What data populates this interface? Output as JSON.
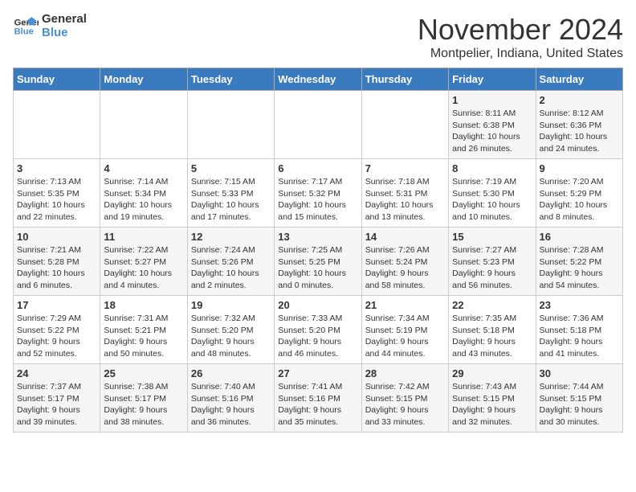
{
  "logo": {
    "line1": "General",
    "line2": "Blue"
  },
  "title": "November 2024",
  "location": "Montpelier, Indiana, United States",
  "weekdays": [
    "Sunday",
    "Monday",
    "Tuesday",
    "Wednesday",
    "Thursday",
    "Friday",
    "Saturday"
  ],
  "weeks": [
    [
      {
        "day": "",
        "info": ""
      },
      {
        "day": "",
        "info": ""
      },
      {
        "day": "",
        "info": ""
      },
      {
        "day": "",
        "info": ""
      },
      {
        "day": "",
        "info": ""
      },
      {
        "day": "1",
        "info": "Sunrise: 8:11 AM\nSunset: 6:38 PM\nDaylight: 10 hours\nand 26 minutes."
      },
      {
        "day": "2",
        "info": "Sunrise: 8:12 AM\nSunset: 6:36 PM\nDaylight: 10 hours\nand 24 minutes."
      }
    ],
    [
      {
        "day": "3",
        "info": "Sunrise: 7:13 AM\nSunset: 5:35 PM\nDaylight: 10 hours\nand 22 minutes."
      },
      {
        "day": "4",
        "info": "Sunrise: 7:14 AM\nSunset: 5:34 PM\nDaylight: 10 hours\nand 19 minutes."
      },
      {
        "day": "5",
        "info": "Sunrise: 7:15 AM\nSunset: 5:33 PM\nDaylight: 10 hours\nand 17 minutes."
      },
      {
        "day": "6",
        "info": "Sunrise: 7:17 AM\nSunset: 5:32 PM\nDaylight: 10 hours\nand 15 minutes."
      },
      {
        "day": "7",
        "info": "Sunrise: 7:18 AM\nSunset: 5:31 PM\nDaylight: 10 hours\nand 13 minutes."
      },
      {
        "day": "8",
        "info": "Sunrise: 7:19 AM\nSunset: 5:30 PM\nDaylight: 10 hours\nand 10 minutes."
      },
      {
        "day": "9",
        "info": "Sunrise: 7:20 AM\nSunset: 5:29 PM\nDaylight: 10 hours\nand 8 minutes."
      }
    ],
    [
      {
        "day": "10",
        "info": "Sunrise: 7:21 AM\nSunset: 5:28 PM\nDaylight: 10 hours\nand 6 minutes."
      },
      {
        "day": "11",
        "info": "Sunrise: 7:22 AM\nSunset: 5:27 PM\nDaylight: 10 hours\nand 4 minutes."
      },
      {
        "day": "12",
        "info": "Sunrise: 7:24 AM\nSunset: 5:26 PM\nDaylight: 10 hours\nand 2 minutes."
      },
      {
        "day": "13",
        "info": "Sunrise: 7:25 AM\nSunset: 5:25 PM\nDaylight: 10 hours\nand 0 minutes."
      },
      {
        "day": "14",
        "info": "Sunrise: 7:26 AM\nSunset: 5:24 PM\nDaylight: 9 hours\nand 58 minutes."
      },
      {
        "day": "15",
        "info": "Sunrise: 7:27 AM\nSunset: 5:23 PM\nDaylight: 9 hours\nand 56 minutes."
      },
      {
        "day": "16",
        "info": "Sunrise: 7:28 AM\nSunset: 5:22 PM\nDaylight: 9 hours\nand 54 minutes."
      }
    ],
    [
      {
        "day": "17",
        "info": "Sunrise: 7:29 AM\nSunset: 5:22 PM\nDaylight: 9 hours\nand 52 minutes."
      },
      {
        "day": "18",
        "info": "Sunrise: 7:31 AM\nSunset: 5:21 PM\nDaylight: 9 hours\nand 50 minutes."
      },
      {
        "day": "19",
        "info": "Sunrise: 7:32 AM\nSunset: 5:20 PM\nDaylight: 9 hours\nand 48 minutes."
      },
      {
        "day": "20",
        "info": "Sunrise: 7:33 AM\nSunset: 5:20 PM\nDaylight: 9 hours\nand 46 minutes."
      },
      {
        "day": "21",
        "info": "Sunrise: 7:34 AM\nSunset: 5:19 PM\nDaylight: 9 hours\nand 44 minutes."
      },
      {
        "day": "22",
        "info": "Sunrise: 7:35 AM\nSunset: 5:18 PM\nDaylight: 9 hours\nand 43 minutes."
      },
      {
        "day": "23",
        "info": "Sunrise: 7:36 AM\nSunset: 5:18 PM\nDaylight: 9 hours\nand 41 minutes."
      }
    ],
    [
      {
        "day": "24",
        "info": "Sunrise: 7:37 AM\nSunset: 5:17 PM\nDaylight: 9 hours\nand 39 minutes."
      },
      {
        "day": "25",
        "info": "Sunrise: 7:38 AM\nSunset: 5:17 PM\nDaylight: 9 hours\nand 38 minutes."
      },
      {
        "day": "26",
        "info": "Sunrise: 7:40 AM\nSunset: 5:16 PM\nDaylight: 9 hours\nand 36 minutes."
      },
      {
        "day": "27",
        "info": "Sunrise: 7:41 AM\nSunset: 5:16 PM\nDaylight: 9 hours\nand 35 minutes."
      },
      {
        "day": "28",
        "info": "Sunrise: 7:42 AM\nSunset: 5:15 PM\nDaylight: 9 hours\nand 33 minutes."
      },
      {
        "day": "29",
        "info": "Sunrise: 7:43 AM\nSunset: 5:15 PM\nDaylight: 9 hours\nand 32 minutes."
      },
      {
        "day": "30",
        "info": "Sunrise: 7:44 AM\nSunset: 5:15 PM\nDaylight: 9 hours\nand 30 minutes."
      }
    ]
  ]
}
